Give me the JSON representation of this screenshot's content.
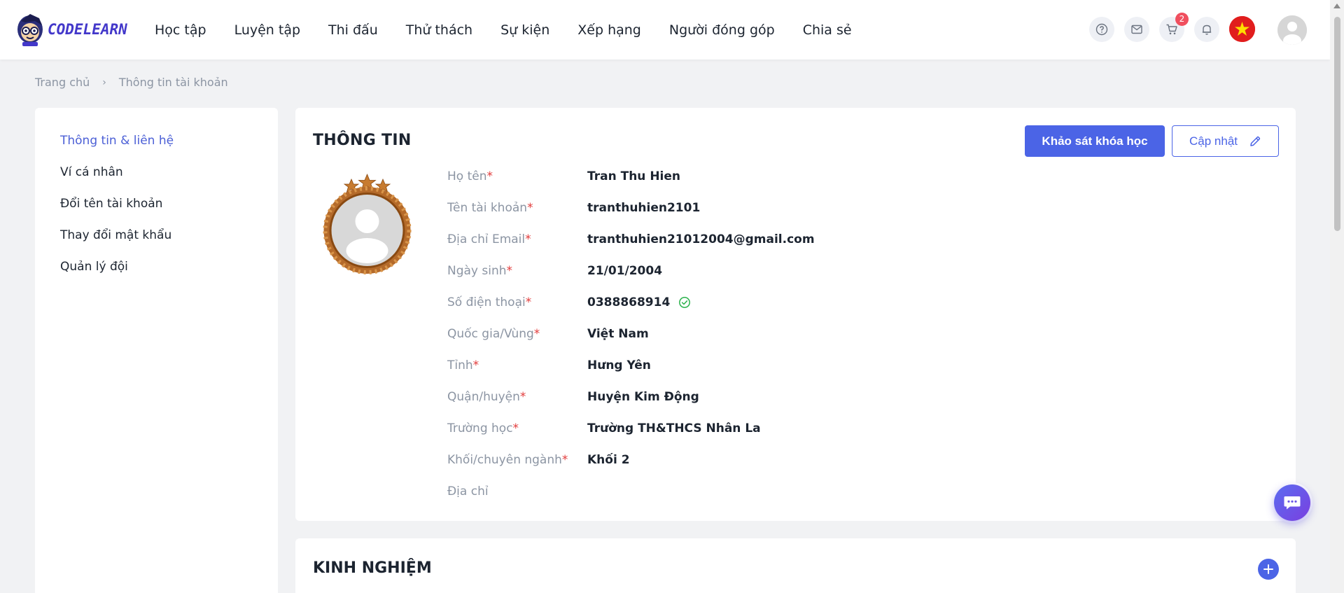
{
  "brand": {
    "name": "CODELEARN"
  },
  "nav": {
    "items": [
      "Học tập",
      "Luyện tập",
      "Thi đấu",
      "Thử thách",
      "Sự kiện",
      "Xếp hạng",
      "Người đóng góp",
      "Chia sẻ"
    ]
  },
  "header_tools": {
    "cart_count": "2"
  },
  "breadcrumb": {
    "home": "Trang chủ",
    "current": "Thông tin tài khoản"
  },
  "sidebar": {
    "items": [
      {
        "label": "Thông tin & liên hệ",
        "active": true
      },
      {
        "label": "Ví cá nhân",
        "active": false
      },
      {
        "label": "Đổi tên tài khoản",
        "active": false
      },
      {
        "label": "Thay đổi mật khẩu",
        "active": false
      },
      {
        "label": "Quản lý đội",
        "active": false
      }
    ]
  },
  "info": {
    "title": "THÔNG TIN",
    "survey_button": "Khảo sát khóa học",
    "update_button": "Cập nhật",
    "fields": [
      {
        "label": "Họ tên",
        "required": "*",
        "value": "Tran Thu Hien"
      },
      {
        "label": "Tên tài khoản",
        "required": "*",
        "value": "tranthuhien2101"
      },
      {
        "label": "Địa chỉ Email",
        "required": "*",
        "value": "tranthuhien21012004@gmail.com"
      },
      {
        "label": "Ngày sinh",
        "required": "*",
        "value": "21/01/2004"
      },
      {
        "label": "Số điện thoại",
        "required": "*",
        "value": "0388868914"
      },
      {
        "label": "Quốc gia/Vùng",
        "required": "*",
        "value": "Việt Nam"
      },
      {
        "label": "Tỉnh",
        "required": "*",
        "value": "Hưng Yên"
      },
      {
        "label": "Quận/huyện",
        "required": "*",
        "value": "Huyện Kim Động"
      },
      {
        "label": "Trường học",
        "required": "*",
        "value": "Trường TH&THCS Nhân La"
      },
      {
        "label": "Khối/chuyên ngành",
        "required": "*",
        "value": "Khối 2"
      },
      {
        "label": "Địa chỉ",
        "required": "",
        "value": ""
      }
    ]
  },
  "experience": {
    "title": "KINH NGHIỆM"
  },
  "colors": {
    "accent": "#4b64e6",
    "active_link": "#4b5fd6",
    "required": "#e23b3b",
    "badge": "#f04f5e",
    "verified": "#2bb24c"
  },
  "icons": {
    "help": "question-icon",
    "mail": "mail-icon",
    "cart": "cart-icon",
    "bell": "bell-icon",
    "language": "vietnam-flag-icon",
    "profile": "user-avatar-icon",
    "edit": "pencil-icon",
    "verified": "check-circle-icon",
    "add": "plus-icon",
    "chat": "chat-icon"
  }
}
